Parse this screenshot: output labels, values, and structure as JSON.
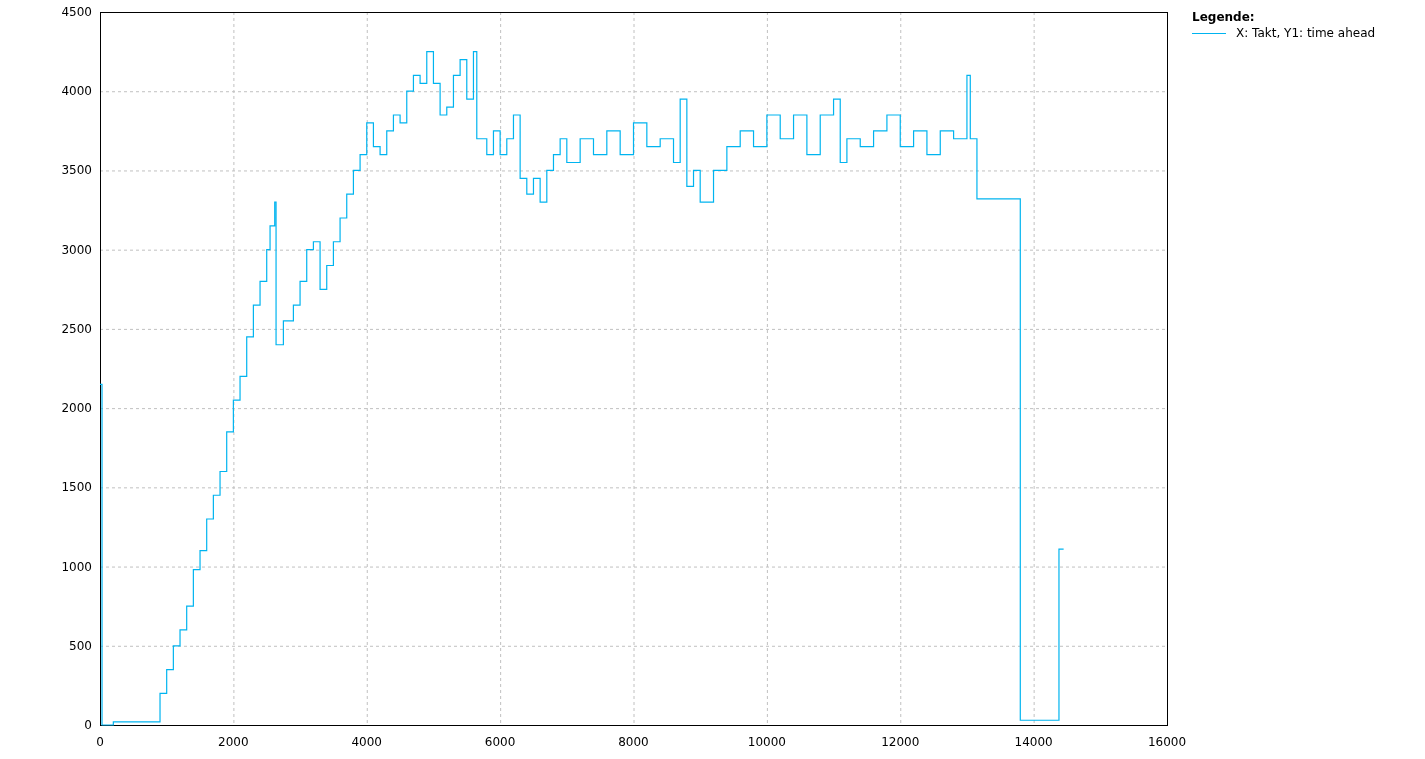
{
  "chart_data": {
    "type": "line",
    "grid": true,
    "xlim": [
      0,
      16000
    ],
    "ylim": [
      0,
      4500
    ],
    "xticks": [
      0,
      2000,
      4000,
      6000,
      8000,
      10000,
      12000,
      14000,
      16000
    ],
    "yticks": [
      0,
      500,
      1000,
      1500,
      2000,
      2500,
      3000,
      3500,
      4000,
      4500
    ],
    "x": [
      0,
      30,
      30,
      200,
      200,
      850,
      900,
      900,
      1000,
      1000,
      1100,
      1100,
      1200,
      1200,
      1300,
      1300,
      1400,
      1400,
      1500,
      1500,
      1600,
      1600,
      1700,
      1700,
      1800,
      1800,
      1900,
      1900,
      2000,
      2000,
      2100,
      2100,
      2200,
      2200,
      2300,
      2300,
      2400,
      2400,
      2500,
      2500,
      2550,
      2550,
      2620,
      2620,
      2640,
      2640,
      2750,
      2750,
      2900,
      2900,
      3000,
      3000,
      3100,
      3100,
      3200,
      3200,
      3300,
      3300,
      3400,
      3400,
      3500,
      3500,
      3600,
      3600,
      3700,
      3700,
      3800,
      3800,
      3900,
      3900,
      4000,
      4000,
      4100,
      4100,
      4200,
      4200,
      4300,
      4300,
      4400,
      4400,
      4500,
      4500,
      4600,
      4600,
      4700,
      4700,
      4800,
      4800,
      4900,
      4900,
      5000,
      5000,
      5100,
      5100,
      5200,
      5200,
      5300,
      5300,
      5400,
      5400,
      5500,
      5500,
      5600,
      5600,
      5650,
      5650,
      5800,
      5800,
      5900,
      5900,
      6000,
      6000,
      6100,
      6100,
      6200,
      6200,
      6300,
      6300,
      6400,
      6400,
      6500,
      6500,
      6600,
      6600,
      6700,
      6700,
      6800,
      6800,
      6900,
      6900,
      7000,
      7000,
      7200,
      7200,
      7400,
      7400,
      7600,
      7600,
      7800,
      7800,
      8000,
      8000,
      8200,
      8200,
      8400,
      8400,
      8600,
      8600,
      8700,
      8700,
      8800,
      8800,
      8900,
      8900,
      9000,
      9000,
      9200,
      9200,
      9400,
      9400,
      9600,
      9600,
      9800,
      9800,
      10000,
      10000,
      10200,
      10200,
      10400,
      10400,
      10600,
      10600,
      10800,
      10800,
      11000,
      11000,
      11100,
      11100,
      11200,
      11200,
      11400,
      11400,
      11600,
      11600,
      11800,
      11800,
      12000,
      12000,
      12200,
      12200,
      12400,
      12400,
      12600,
      12600,
      12800,
      12800,
      13000,
      13000,
      13050,
      13050,
      13150,
      13150,
      13800,
      13800,
      14380,
      14380,
      14450
    ],
    "series": [
      {
        "name": "X: Takt, Y1: time ahead",
        "color": "#00b4f0",
        "values": [
          2150,
          2150,
          0,
          0,
          20,
          20,
          20,
          200,
          200,
          350,
          350,
          500,
          500,
          600,
          600,
          750,
          750,
          980,
          980,
          1100,
          1100,
          1300,
          1300,
          1450,
          1450,
          1600,
          1600,
          1850,
          1850,
          2050,
          2050,
          2200,
          2200,
          2450,
          2450,
          2650,
          2650,
          2800,
          2800,
          3000,
          3000,
          3150,
          3150,
          3300,
          3300,
          2400,
          2400,
          2550,
          2550,
          2650,
          2650,
          2800,
          2800,
          3000,
          3000,
          3050,
          3050,
          2750,
          2750,
          2900,
          2900,
          3050,
          3050,
          3200,
          3200,
          3350,
          3350,
          3500,
          3500,
          3600,
          3600,
          3800,
          3800,
          3650,
          3650,
          3600,
          3600,
          3750,
          3750,
          3850,
          3850,
          3800,
          3800,
          4000,
          4000,
          4100,
          4100,
          4050,
          4050,
          4250,
          4250,
          4050,
          4050,
          3850,
          3850,
          3900,
          3900,
          4100,
          4100,
          4200,
          4200,
          3950,
          3950,
          4250,
          4250,
          3700,
          3700,
          3600,
          3600,
          3750,
          3750,
          3600,
          3600,
          3700,
          3700,
          3850,
          3850,
          3450,
          3450,
          3350,
          3350,
          3450,
          3450,
          3300,
          3300,
          3500,
          3500,
          3600,
          3600,
          3700,
          3700,
          3550,
          3550,
          3700,
          3700,
          3600,
          3600,
          3750,
          3750,
          3600,
          3600,
          3800,
          3800,
          3650,
          3650,
          3700,
          3700,
          3550,
          3550,
          3950,
          3950,
          3400,
          3400,
          3500,
          3500,
          3300,
          3300,
          3500,
          3500,
          3650,
          3650,
          3750,
          3750,
          3650,
          3650,
          3850,
          3850,
          3700,
          3700,
          3850,
          3850,
          3600,
          3600,
          3850,
          3850,
          3950,
          3950,
          3550,
          3550,
          3700,
          3700,
          3650,
          3650,
          3750,
          3750,
          3850,
          3850,
          3650,
          3650,
          3750,
          3750,
          3600,
          3600,
          3750,
          3750,
          3700,
          3700,
          4100,
          4100,
          3700,
          3700,
          3320,
          3320,
          30,
          30,
          1110,
          1110
        ]
      }
    ]
  },
  "legend": {
    "title": "Legende:"
  }
}
